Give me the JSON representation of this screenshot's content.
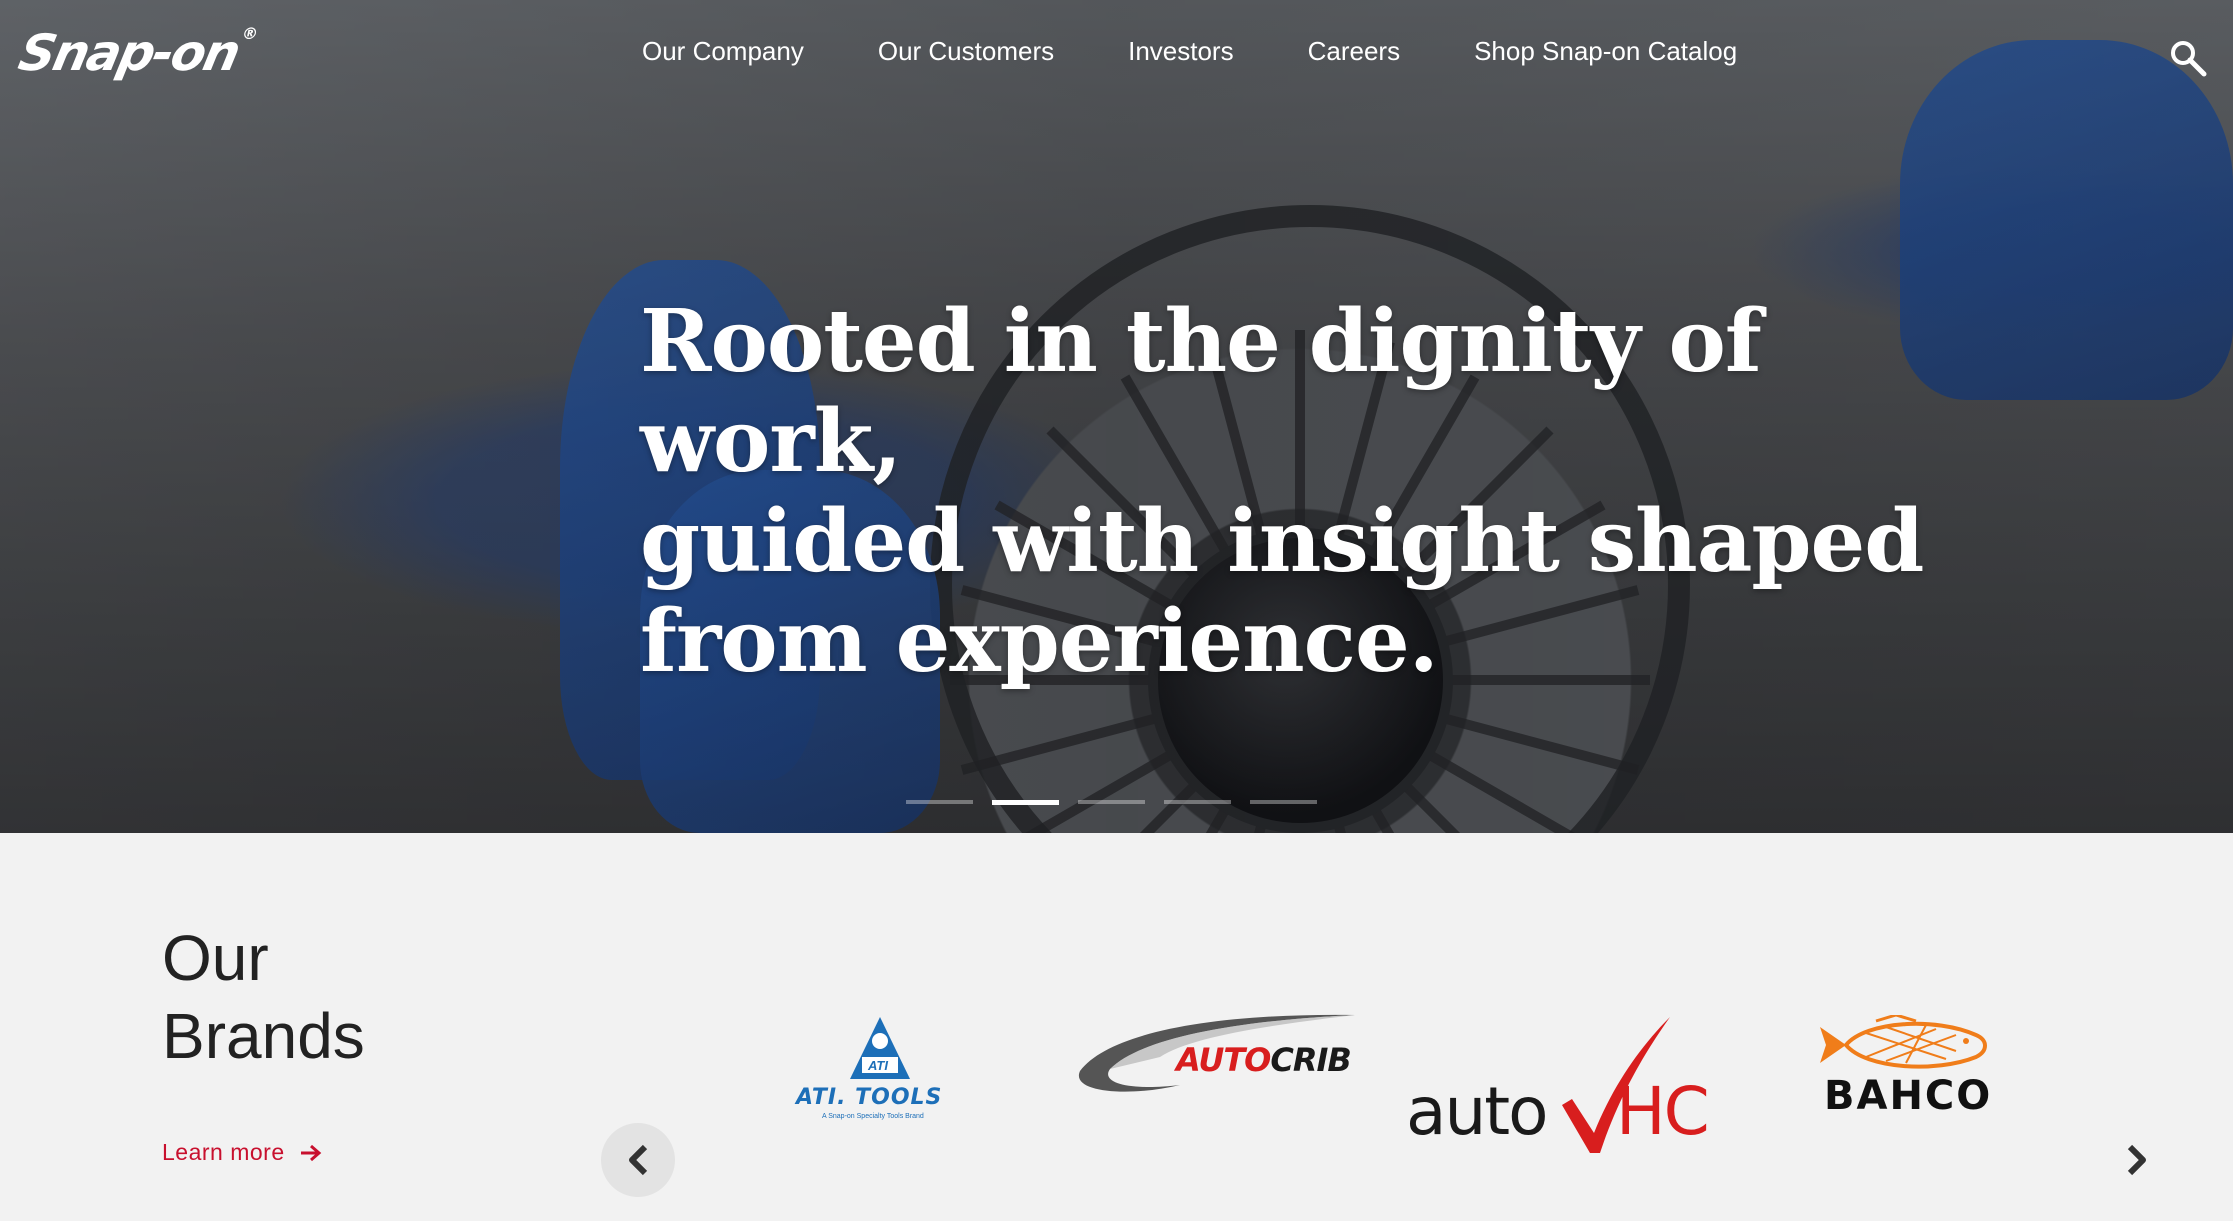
{
  "brand": {
    "logo_text": "Snap-on",
    "logo_mark": "®"
  },
  "nav": {
    "items": [
      {
        "label": "Our Company"
      },
      {
        "label": "Our Customers"
      },
      {
        "label": "Investors"
      },
      {
        "label": "Careers"
      },
      {
        "label": "Shop Snap-on Catalog"
      }
    ],
    "search_icon": "search-icon"
  },
  "hero": {
    "headline_lines": [
      "Rooted in the dignity of work,",
      "guided with insight shaped",
      "from experience."
    ],
    "carousel": {
      "total": 5,
      "active_index": 1
    }
  },
  "brands": {
    "title_lines": [
      "Our",
      "Brands"
    ],
    "learn_more": "Learn more",
    "logos": {
      "ati": {
        "name": "ATI. TOOLS",
        "tagline": "A Snap-on Specialty Tools Brand",
        "badge": "ATI"
      },
      "autocrib": {
        "part1": "AUTO",
        "part2": "CRIB"
      },
      "autovhc": {
        "part1": "auto",
        "part2": "HC"
      },
      "bahco": {
        "name": "BAHCO"
      }
    }
  },
  "colors": {
    "accent_red": "#c8102e",
    "ati_blue": "#1d6fb8",
    "bahco_orange": "#f07d1a",
    "section_bg": "#f2f2f2"
  }
}
